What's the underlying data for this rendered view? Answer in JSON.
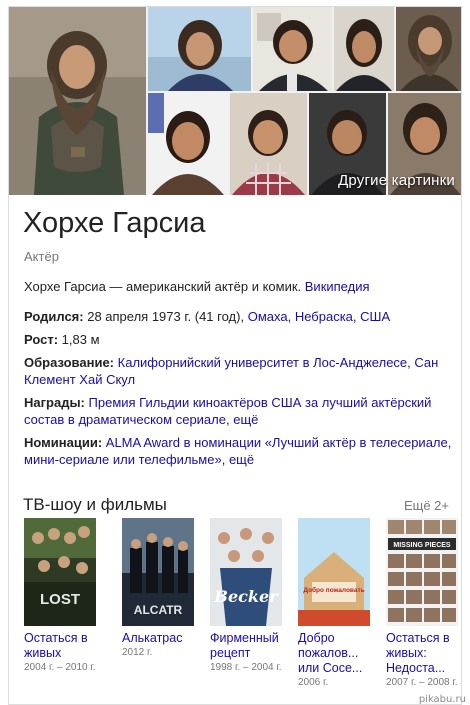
{
  "gallery": {
    "more_label": "Другие картинки"
  },
  "entity": {
    "title": "Хорхе Гарсиа",
    "subtitle": "Актёр",
    "description": "Хорхе Гарсиа — американский актёр и комик.",
    "description_link": "Википедия"
  },
  "facts": {
    "born": {
      "label": "Родился:",
      "text": "28 апреля 1973 г. (41 год),",
      "link1": "Омаха",
      "link2": "Небраска",
      "link3": "США"
    },
    "height": {
      "label": "Рост:",
      "text": "1,83 м"
    },
    "education": {
      "label": "Образование:",
      "link": "Калифорнийский университет в Лос-Анджелесе, Сан Клемент Хай Скул"
    },
    "awards": {
      "label": "Награды:",
      "link": "Премия Гильдии киноактёров США за лучший актёрский состав в драматическом сериале",
      "more": "ещё"
    },
    "nominations": {
      "label": "Номинации:",
      "link": "ALMA Award в номинации «Лучший актёр в телесериале, мини-сериале или телефильме»",
      "more": "ещё"
    }
  },
  "shows": {
    "title": "ТВ-шоу и фильмы",
    "more": "Ещё 2+",
    "items": [
      {
        "title": "Остаться в живых",
        "years": "2004 г. – 2010 г.",
        "poster_text": "LOST"
      },
      {
        "title": "Алькатрас",
        "years": "2012 г.",
        "poster_text": "ALCATR"
      },
      {
        "title": "Фирменный рецепт",
        "years": "1998 г. – 2004 г.",
        "poster_text": "Becker"
      },
      {
        "title": "Добро пожалов... или Сосе...",
        "years": "2006 г.",
        "poster_text": "Добро пожаловать"
      },
      {
        "title": "Остаться в живых: Недоста...",
        "years": "2007 г. – 2008 г.",
        "poster_text": "MISSING PIECES"
      }
    ]
  },
  "watermark": "pikabu.ru"
}
